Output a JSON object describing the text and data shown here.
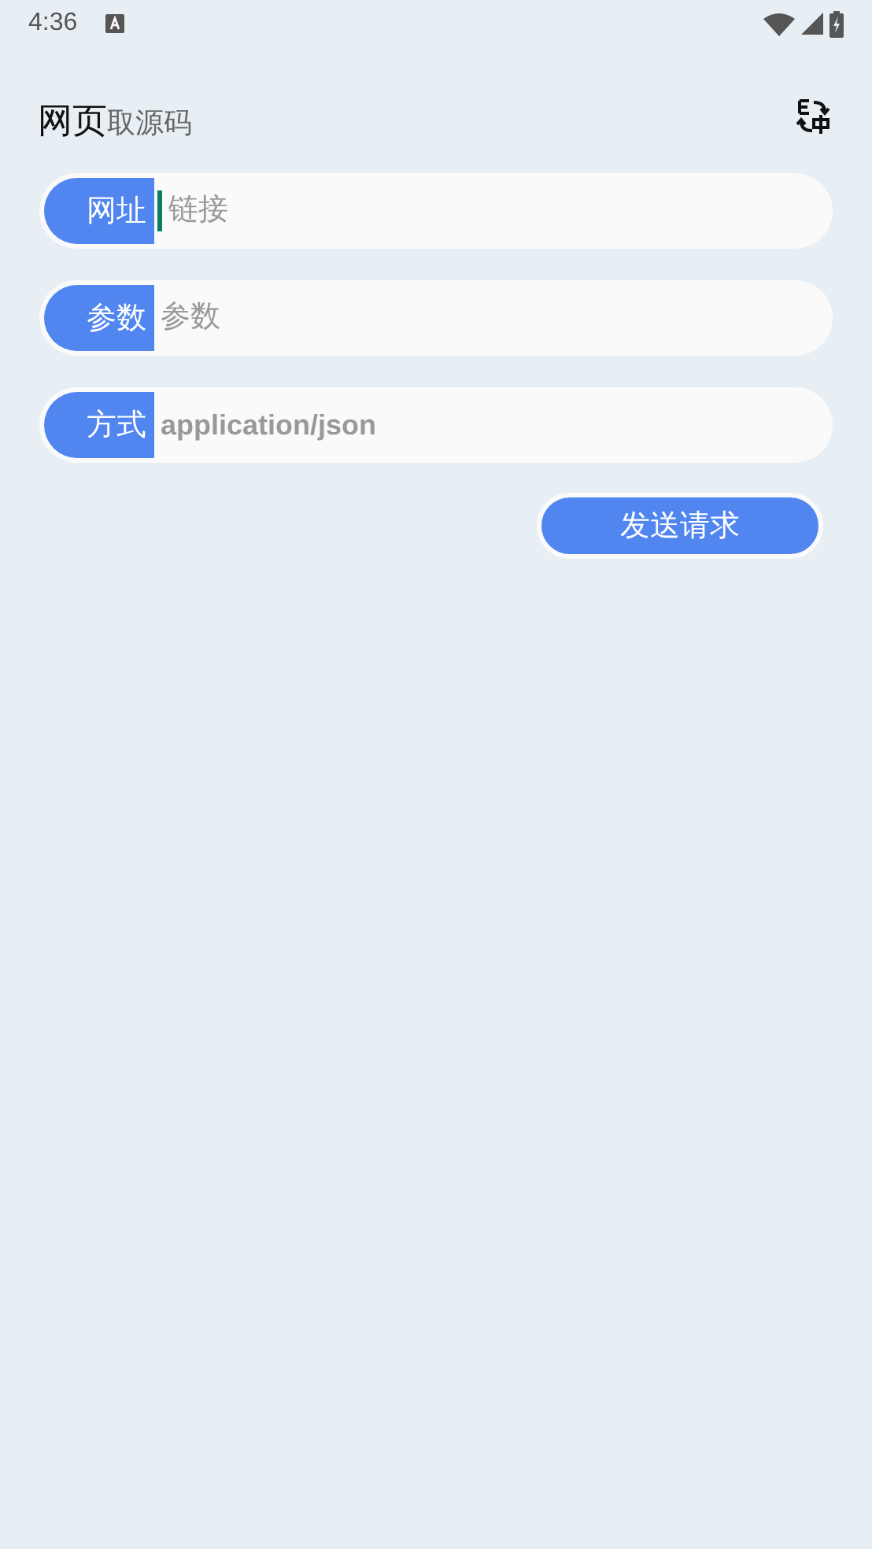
{
  "status_bar": {
    "time": "4:36"
  },
  "app_bar": {
    "title": "网页",
    "subtitle": "取源码"
  },
  "fields": [
    {
      "label": "网址",
      "placeholder": "链接",
      "focused": true
    },
    {
      "label": "参数",
      "placeholder": "参数",
      "focused": false
    },
    {
      "label": "方式",
      "placeholder": "application/json",
      "focused": false
    }
  ],
  "send_button": "发送请求"
}
